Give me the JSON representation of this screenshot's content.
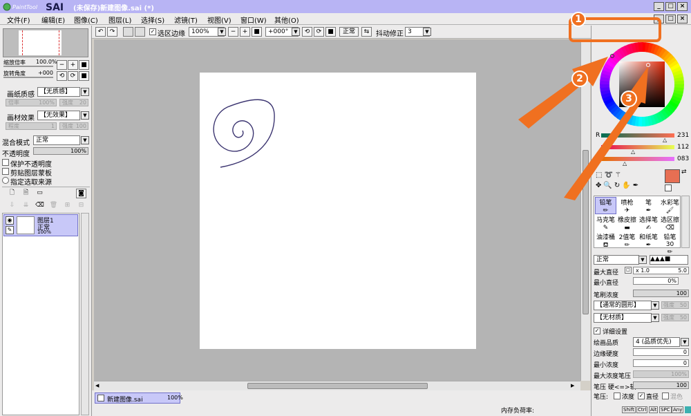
{
  "window": {
    "logo_text": "PaintTool SAI",
    "title": "(未保存)新建图像.sai (*)"
  },
  "menu": [
    "文件(F)",
    "编辑(E)",
    "图像(C)",
    "图层(L)",
    "选择(S)",
    "滤镜(T)",
    "视图(V)",
    "窗口(W)",
    "其他(O)"
  ],
  "toolbar": {
    "selection_edge_label": "选区边缘",
    "zoom_value": "100%",
    "rotation_value": "+000°",
    "mode_label": "正常",
    "stabilizer_label": "抖动修正",
    "stabilizer_value": "3"
  },
  "navigator": {
    "zoom_label": "缩放倍率",
    "zoom_value": "100.0%",
    "angle_label": "旋转角度",
    "angle_value": "+000"
  },
  "layer_props": {
    "paper_texture_label": "画纸质感",
    "paper_texture_value": "【无质感】",
    "scale_label": "倍率",
    "scale_value": "100%",
    "strength_label": "强度",
    "strength_value": "20",
    "material_effect_label": "画材效果",
    "material_effect_value": "【无效果】",
    "degree_label": "程度",
    "degree_value": "1",
    "strength2_label": "强度",
    "strength2_value": "100",
    "blend_mode_label": "混合模式",
    "blend_mode_value": "正常",
    "opacity_label": "不透明度",
    "opacity_value": "100%",
    "preserve_opacity": "保护不透明度",
    "clip_group": "剪贴图层蒙板",
    "selection_source": "指定选取来源"
  },
  "layer": {
    "name": "图层1",
    "mode": "正常",
    "opacity": "100%"
  },
  "bottom": {
    "document_tab": "新建图像.sai",
    "document_zoom": "100%",
    "memory_label": "内存负荷率:",
    "keys": [
      "Shift",
      "Ctrl",
      "Alt",
      "SPC",
      "Any"
    ]
  },
  "color": {
    "r_label": "R",
    "r_value": "231",
    "g_value": "112",
    "b_value": "083",
    "current_hex": "#e76f53",
    "stroke_hex": "#3b3470"
  },
  "brushes": [
    {
      "name": "铅笔",
      "icon": "pencil-icon"
    },
    {
      "name": "喷枪",
      "icon": "airbrush-icon"
    },
    {
      "name": "笔",
      "icon": "pen-icon"
    },
    {
      "name": "水彩笔",
      "icon": "watercolor-icon"
    },
    {
      "name": "马克笔",
      "icon": "marker-icon"
    },
    {
      "name": "橡皮擦",
      "icon": "eraser-icon"
    },
    {
      "name": "选择笔",
      "icon": "select-pen-icon"
    },
    {
      "name": "选区擦",
      "icon": "select-eraser-icon"
    },
    {
      "name": "油漆桶",
      "icon": "bucket-icon"
    },
    {
      "name": "2值笔",
      "icon": "binary-pen-icon"
    },
    {
      "name": "和纸笔",
      "icon": "washi-pen-icon"
    },
    {
      "name": "铅笔30",
      "icon": "pencil30-icon"
    }
  ],
  "brush_settings": {
    "mode": "正常",
    "max_size_label": "最大直径",
    "max_size_mult": "x 1.0",
    "max_size_value": "5.0",
    "min_size_label": "最小直径",
    "min_size_value": "0%",
    "density_label": "笔刷浓度",
    "density_value": "100",
    "shape_value": "【通常的圆形】",
    "shape_strength_label": "强度",
    "shape_strength_value": "50",
    "texture_value": "【无材质】",
    "texture_strength_label": "强度",
    "texture_strength_value": "50",
    "detail_label": "详细设置",
    "quality_label": "绘画品质",
    "quality_value": "4 (品质优先)",
    "edge_hardness_label": "边缘硬度",
    "edge_hardness_value": "0",
    "min_density_label": "最小浓度",
    "min_density_value": "0",
    "max_pressure_label": "最大浓度笔压",
    "max_pressure_value": "100%",
    "pressure_label": "笔压 硬<=>软",
    "pressure_value": "100",
    "pressure_opts_label": "笔压:",
    "pressure_density": "浓度",
    "pressure_size": "直径",
    "pressure_blend": "混色"
  },
  "callouts": [
    "1",
    "2",
    "3"
  ],
  "accent_colors": {
    "orange": "#f07020",
    "titlebar": "#b8b4f4"
  }
}
